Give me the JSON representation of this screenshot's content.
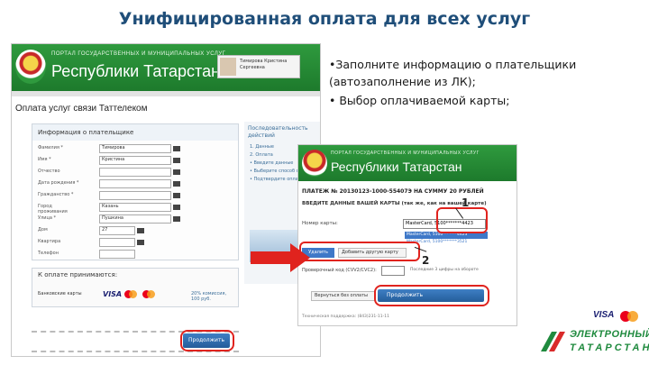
{
  "slide": {
    "title": "Унифицированная оплата для всех услуг",
    "bullets": [
      "•Заполните информацию о плательщики (автозаполнение из ЛК);",
      "• Выбор оплачиваемой карты;"
    ]
  },
  "portal": {
    "header_small": "ПОРТАЛ ГОСУДАРСТВЕННЫХ И МУНИЦИПАЛЬНЫХ УСЛУГ",
    "header_big": "Республики Татарстан",
    "user_name": "Тимирова Кристина Сергеевна"
  },
  "screen1": {
    "page_title": "Оплата услуг связи Таттелеком",
    "panel_title": "Информация о плательщике",
    "fields": [
      {
        "label": "Фамилия *",
        "value": "Тимирова"
      },
      {
        "label": "Имя *",
        "value": "Кристина"
      },
      {
        "label": "Отчество",
        "value": ""
      },
      {
        "label": "Дата рождения *",
        "value": ""
      },
      {
        "label": "Гражданство *",
        "value": ""
      },
      {
        "label": "Город проживания",
        "value": "Казань"
      },
      {
        "label": "Улица *",
        "value": "Пушкина"
      },
      {
        "label": "Дом",
        "value": "27"
      },
      {
        "label": "Квартира",
        "value": ""
      },
      {
        "label": "Телефон",
        "value": ""
      }
    ],
    "right_title": "Последовательность действий",
    "right_items": [
      "1. Данные",
      "2. Оплата",
      "• Введите данные",
      "• Выберите способ оплаты",
      "• Подтвердите оплату"
    ],
    "pay_title": "К оплате принимаются:",
    "pay_label": "Банковские карты",
    "visa": "VISA",
    "pay_amount": "20% комиссия, 100 руб.",
    "continue_label": "Продолжить"
  },
  "screen2": {
    "payment_title": "ПЛАТЕЖ № 20130123-1000-55407Э НА СУММУ 20 РУБЛЕЙ",
    "subtitle": "ВВЕДИТЕ ДАННЫЕ ВАШЕЙ КАРТЫ (так же, как на вашей карте)",
    "card_label": "Номер карты:",
    "card_value": "MasterCard, 5100*******4423",
    "card_options": [
      "MasterCard, 5100*******4423",
      "MasterCard, 5100*******3521"
    ],
    "delete_label": "Удалить",
    "add_label": "Добавить другую карту",
    "cvv_label": "Проверочный код (CVV2/CVC2):",
    "cvv_hint": "Последние 3 цифры на обороте",
    "back_label": "Вернуться без оплаты",
    "continue_label": "Продолжить",
    "footer": "Техническая поддержка: (843)231-11-11"
  },
  "annotations": {
    "marker1": "1",
    "marker2": "2"
  },
  "footer": {
    "visa": "VISA",
    "brand_line1": "ЭЛЕКТРОННЫЙ",
    "brand_line2": "ТАТАРСТАН"
  },
  "colors": {
    "title": "#1f4e79",
    "header_green": "#2f9a3e",
    "highlight_red": "#e0231e",
    "button_blue": "#3e78c8"
  }
}
